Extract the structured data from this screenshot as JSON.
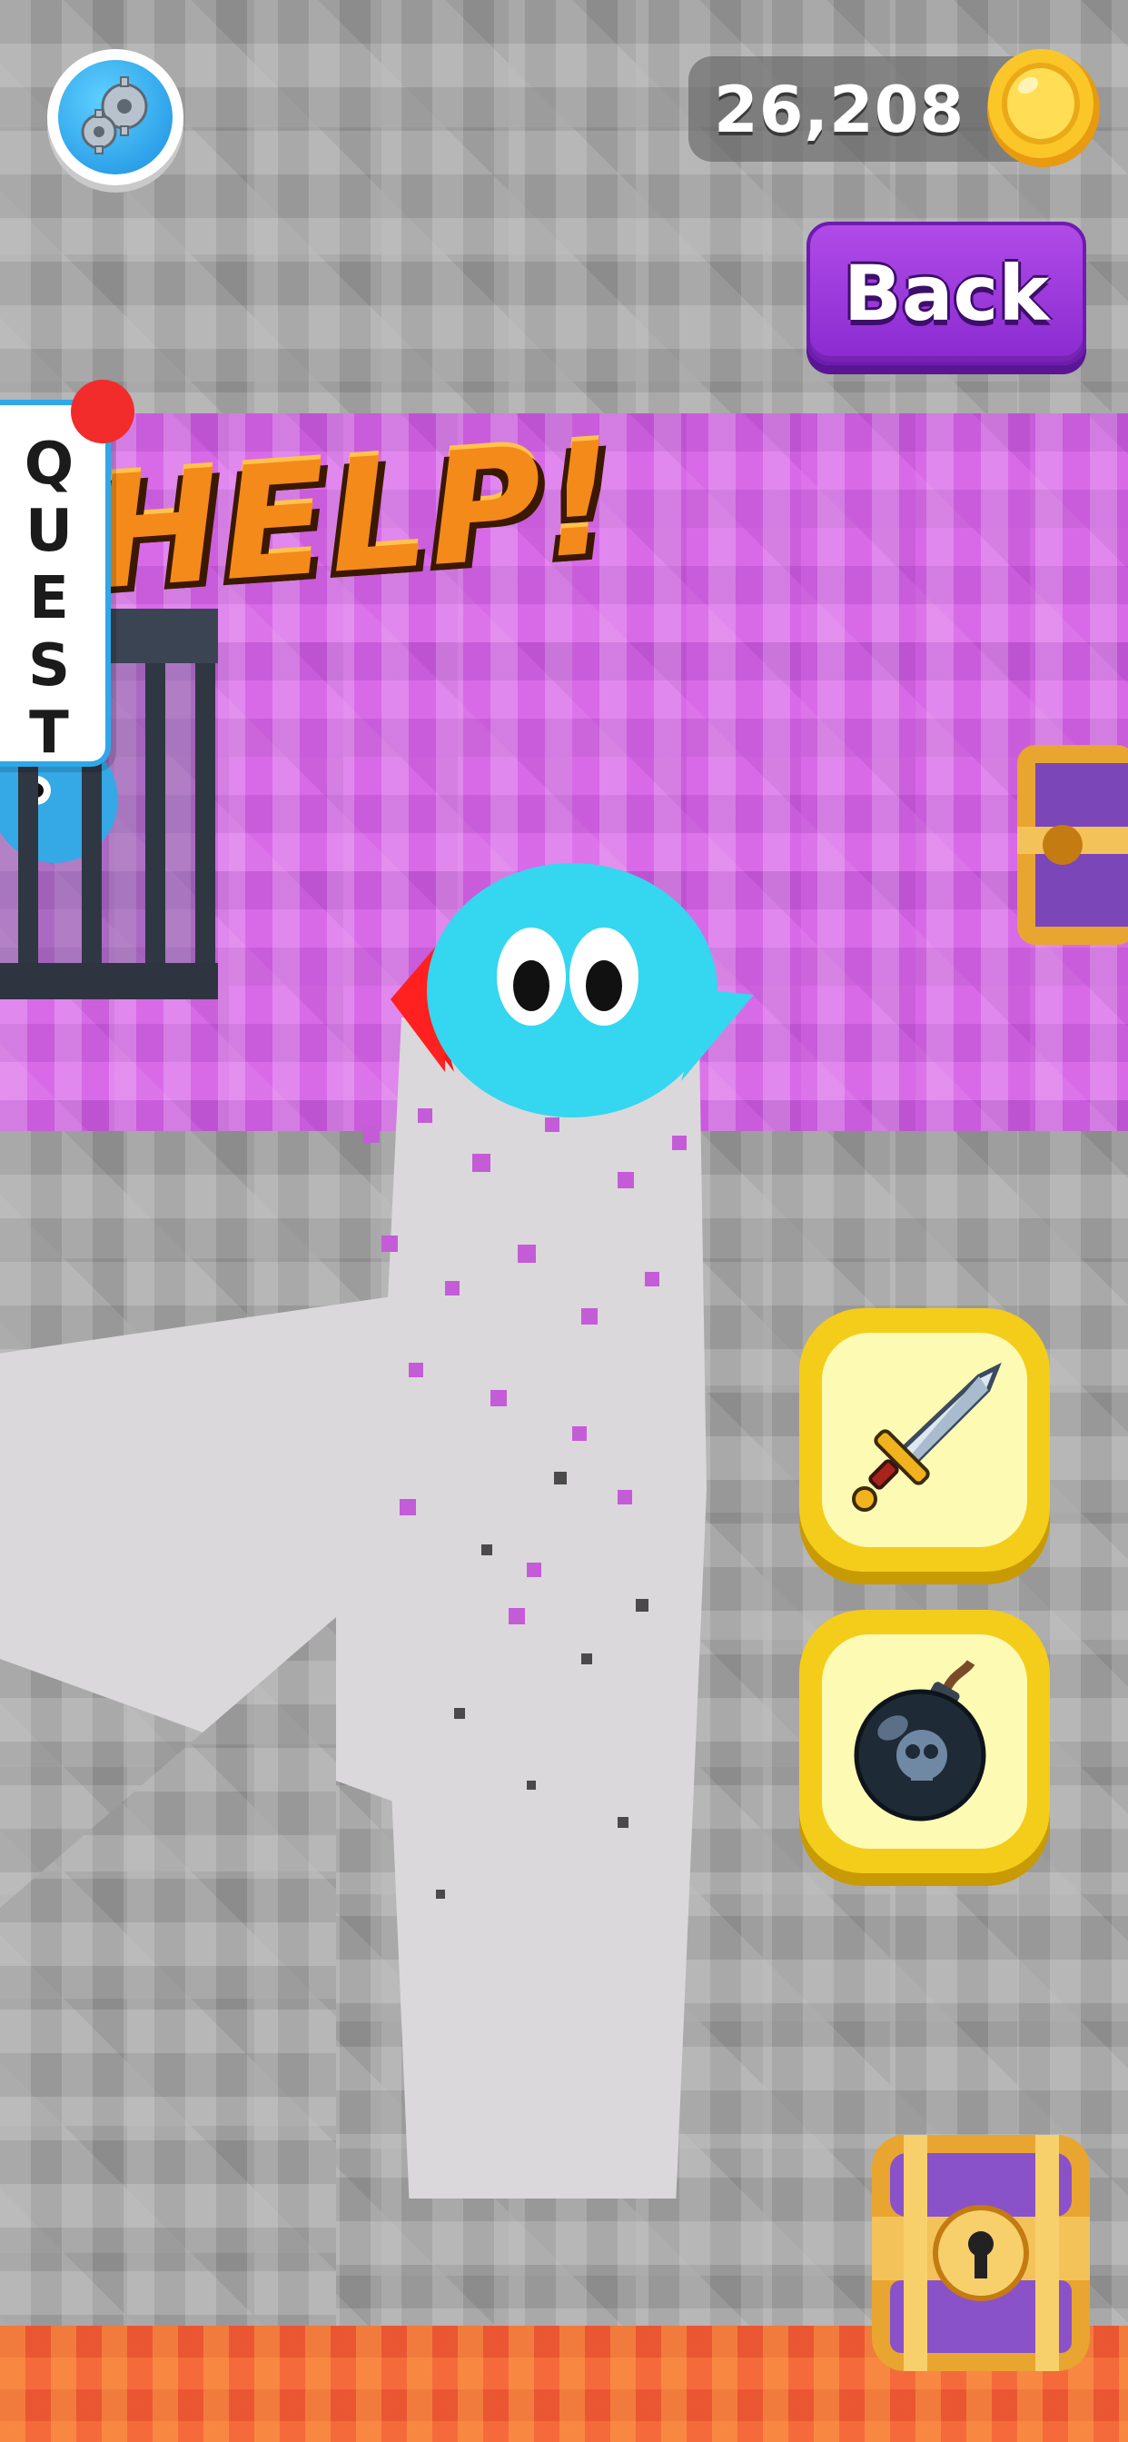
{
  "hud": {
    "coins": "26,208",
    "back_label": "Back",
    "quest_label": "QUEST",
    "help_text": "HELP!"
  },
  "icons": {
    "settings": "gears-icon",
    "coin": "gold-coin-icon",
    "sword": "sword-icon",
    "bomb": "skull-bomb-icon",
    "chest": "treasure-chest-icon",
    "cage": "cage-icon"
  },
  "colors": {
    "purple_button": "#9b36dc",
    "ability_button": "#f4cd1a",
    "player": "#35d6ef",
    "quest_border": "#2ea8e8",
    "notification_dot": "#f22b2b"
  }
}
